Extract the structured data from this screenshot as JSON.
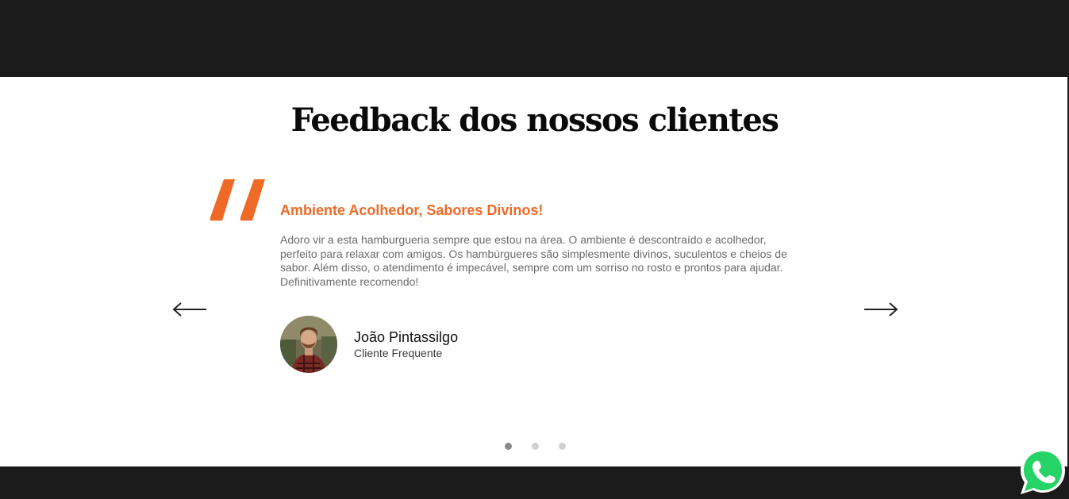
{
  "section": {
    "title": "Feedback dos nossos clientes"
  },
  "testimonial": {
    "heading": "Ambiente Acolhedor, Sabores Divinos!",
    "text": "Adoro vir a esta hamburgueria sempre que estou na área. O ambiente é descontraído e acolhedor, perfeito para relaxar com amigos. Os hambúrgueres são simplesmente divinos, suculentos e cheios de sabor. Além disso, o atendimento é impecável, sempre com um sorriso no rosto e prontos para ajudar. Definitivamente recomendo!",
    "author_name": "João Pintassilgo",
    "author_role": "Cliente Frequente"
  },
  "carousel": {
    "slide_count": 3,
    "active_index": 0
  },
  "colors": {
    "accent": "#ef6a27",
    "dark_band": "#1b1b1b",
    "whatsapp": "#25d366"
  },
  "icons": {
    "quote": "quote-icon",
    "prev": "arrow-left-icon",
    "next": "arrow-right-icon",
    "whatsapp": "whatsapp-icon"
  }
}
